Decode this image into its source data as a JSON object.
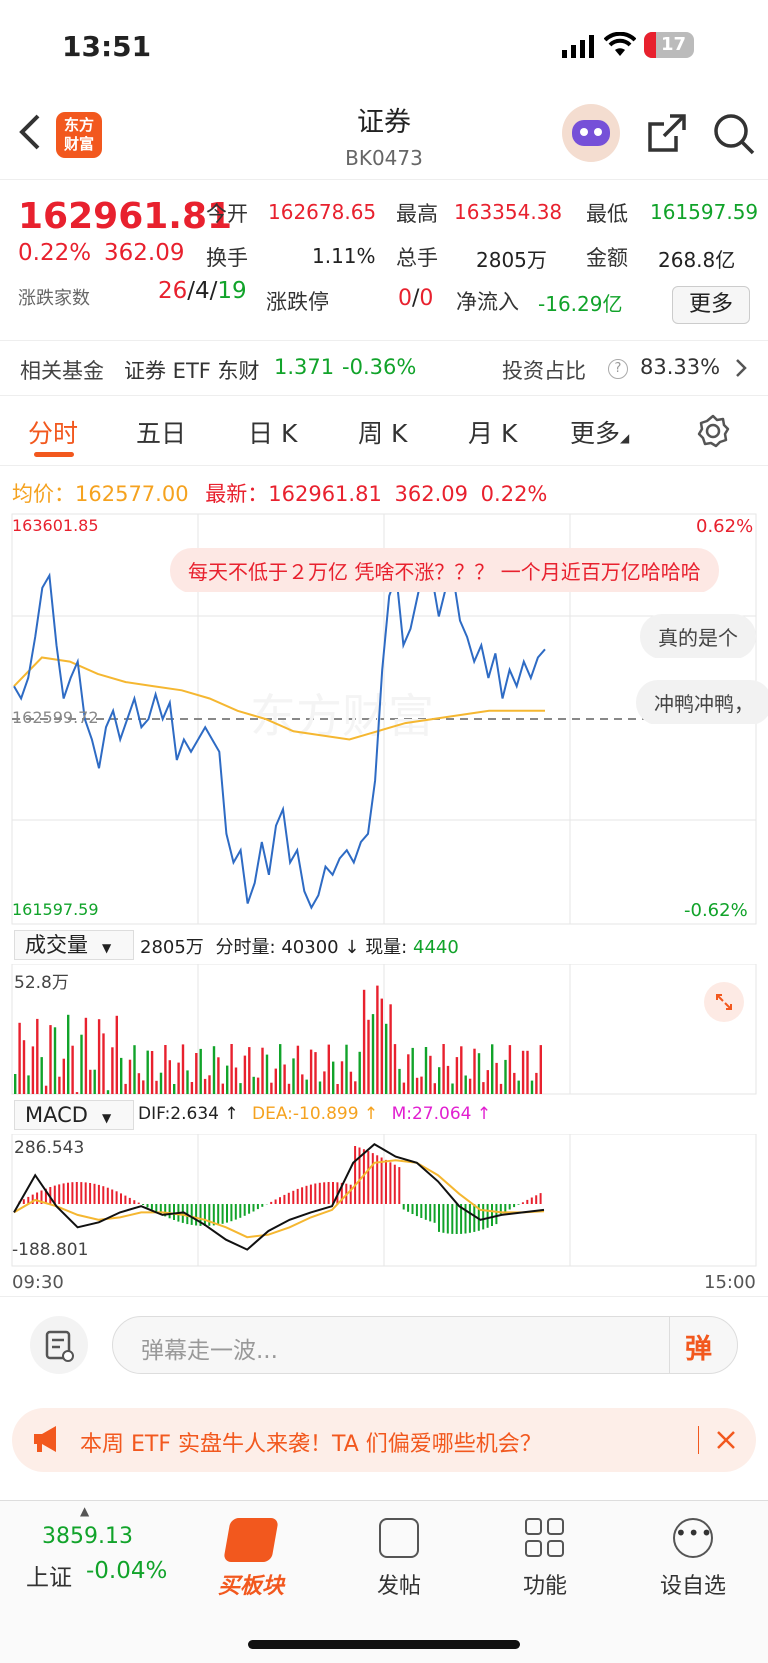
{
  "status_bar": {
    "time": "13:51",
    "battery": "17"
  },
  "header": {
    "logo_text": "东方财富",
    "title": "证券",
    "code": "BK0473"
  },
  "quote": {
    "price": "162961.81",
    "change_pct": "0.22%",
    "change": "362.09",
    "open_label": "今开",
    "open": "162678.65",
    "high_label": "最高",
    "high": "163354.38",
    "low_label": "最低",
    "low": "161597.59",
    "turnover_label": "换手",
    "turnover": "1.11%",
    "volume_label": "总手",
    "volume": "2805万",
    "amount_label": "金额",
    "amount": "268.8亿",
    "breadth_label": "涨跌家数",
    "breadth_up": "26",
    "breadth_flat": "4",
    "breadth_down": "19",
    "limit_label": "涨跌停",
    "limit_up": "0",
    "limit_down": "0",
    "inflow_label": "净流入",
    "inflow": "-16.29亿",
    "more": "更多"
  },
  "fund": {
    "label": "相关基金",
    "name": "证券 ETF 东财",
    "price": "1.371",
    "change": "-0.36%",
    "ratio_label": "投资占比",
    "ratio": "83.33%"
  },
  "tabs": [
    "分时",
    "五日",
    "日 K",
    "周 K",
    "月 K",
    "更多"
  ],
  "active_tab": "分时",
  "info_line": {
    "avg_label": "均价：",
    "avg": "162577.00",
    "latest_label": "最新：",
    "latest": "162961.81",
    "change": "362.09",
    "pct": "0.22%"
  },
  "chart": {
    "y_max": "163601.85",
    "y_min": "161597.59",
    "y_prev": "162599.72",
    "pct_max": "0.62%",
    "pct_min": "-0.62%",
    "time_start": "09:30",
    "time_end": "15:00",
    "watermark": "东方财富",
    "danmaku": [
      "每天不低于２万亿 凭啥不涨？？？ 一个月近百万亿哈哈哈",
      "真的是个",
      "冲鸭冲鸭，"
    ]
  },
  "volume_panel": {
    "selector": "成交量",
    "total": "2805万",
    "tick_label": "分时量:",
    "tick": "40300",
    "arrow": "↓",
    "cur_label": "现量:",
    "cur": "4440",
    "max": "52.8万"
  },
  "macd_panel": {
    "selector": "MACD",
    "dif": "DIF:2.634 ↑",
    "dea": "DEA:-10.899 ↑",
    "m": "M:27.064 ↑",
    "max": "286.543",
    "min": "-188.801"
  },
  "comment_bar": {
    "placeholder": "弹幕走一波...",
    "btn": "弹"
  },
  "banner": {
    "text": "本周 ETF 实盘牛人来袭！TA 们偏爱哪些机会？"
  },
  "bottom_nav": {
    "index_value": "3859.13",
    "index_name": "上证",
    "index_change": "-0.04%",
    "items": [
      "买板块",
      "发帖",
      "功能",
      "设自选"
    ]
  },
  "colors": {
    "up": "#e8212e",
    "down": "#11a32a",
    "price_line": "#2e6bc4",
    "avg_line": "#f5b731",
    "brand": "#f2581e"
  }
}
